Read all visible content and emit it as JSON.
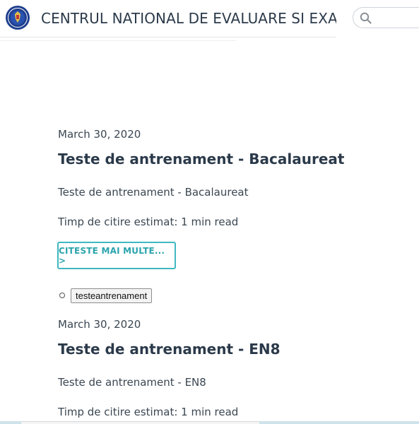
{
  "header": {
    "site_title": "CENTRUL NATIONAL DE EVALUARE SI EXAMINARE",
    "logo_icon": "romanian-government-seal-icon",
    "search_icon": "search-icon",
    "search_placeholder": ""
  },
  "posts": [
    {
      "date": "March 30, 2020",
      "title": "Teste de antrenament - Bacalaureat",
      "excerpt": "Teste de antrenament - Bacalaureat",
      "read_time": "Timp de citire estimat: 1 min read",
      "read_more_label": "CITESTE MAI MULTE... >",
      "tags": [
        "testeantrenament"
      ]
    },
    {
      "date": "March 30, 2020",
      "title": "Teste de antrenament - EN8",
      "excerpt": "Teste de antrenament - EN8",
      "read_time": "Timp de citire estimat: 1 min read"
    }
  ],
  "colors": {
    "accent": "#3fb8c0",
    "heading": "#2b3a4a",
    "logo_blue": "#1f3f8f"
  }
}
